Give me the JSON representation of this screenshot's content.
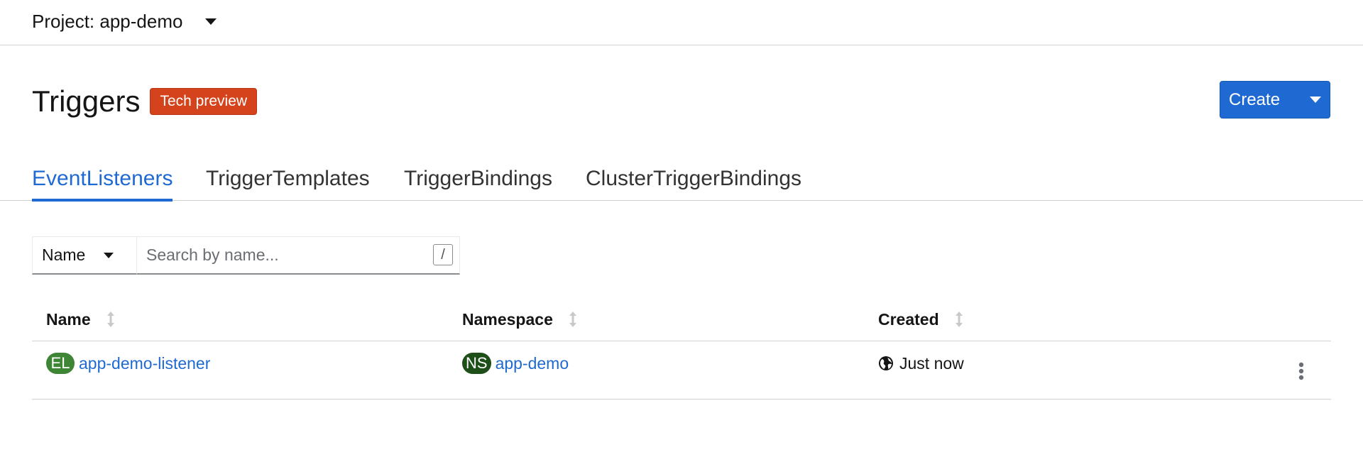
{
  "project": {
    "label": "Project: app-demo"
  },
  "page": {
    "title": "Triggers",
    "badge": "Tech preview",
    "create_label": "Create"
  },
  "tabs": [
    {
      "label": "EventListeners",
      "active": true
    },
    {
      "label": "TriggerTemplates",
      "active": false
    },
    {
      "label": "TriggerBindings",
      "active": false
    },
    {
      "label": "ClusterTriggerBindings",
      "active": false
    }
  ],
  "filter": {
    "selected": "Name",
    "placeholder": "Search by name...",
    "shortcut": "/"
  },
  "table": {
    "columns": [
      "Name",
      "Namespace",
      "Created"
    ],
    "rows": [
      {
        "name_badge": "EL",
        "name": "app-demo-listener",
        "namespace_badge": "NS",
        "namespace": "app-demo",
        "created": "Just now"
      }
    ]
  },
  "colors": {
    "accent": "#1f6ad2",
    "badge": "#d4431c",
    "el_badge": "#3e8635",
    "ns_badge": "#1e4f18"
  },
  "icons": {
    "project_caret": "caret-down-icon",
    "sort": "sort-icon",
    "created": "globe-icon",
    "row_actions": "kebab-icon"
  }
}
